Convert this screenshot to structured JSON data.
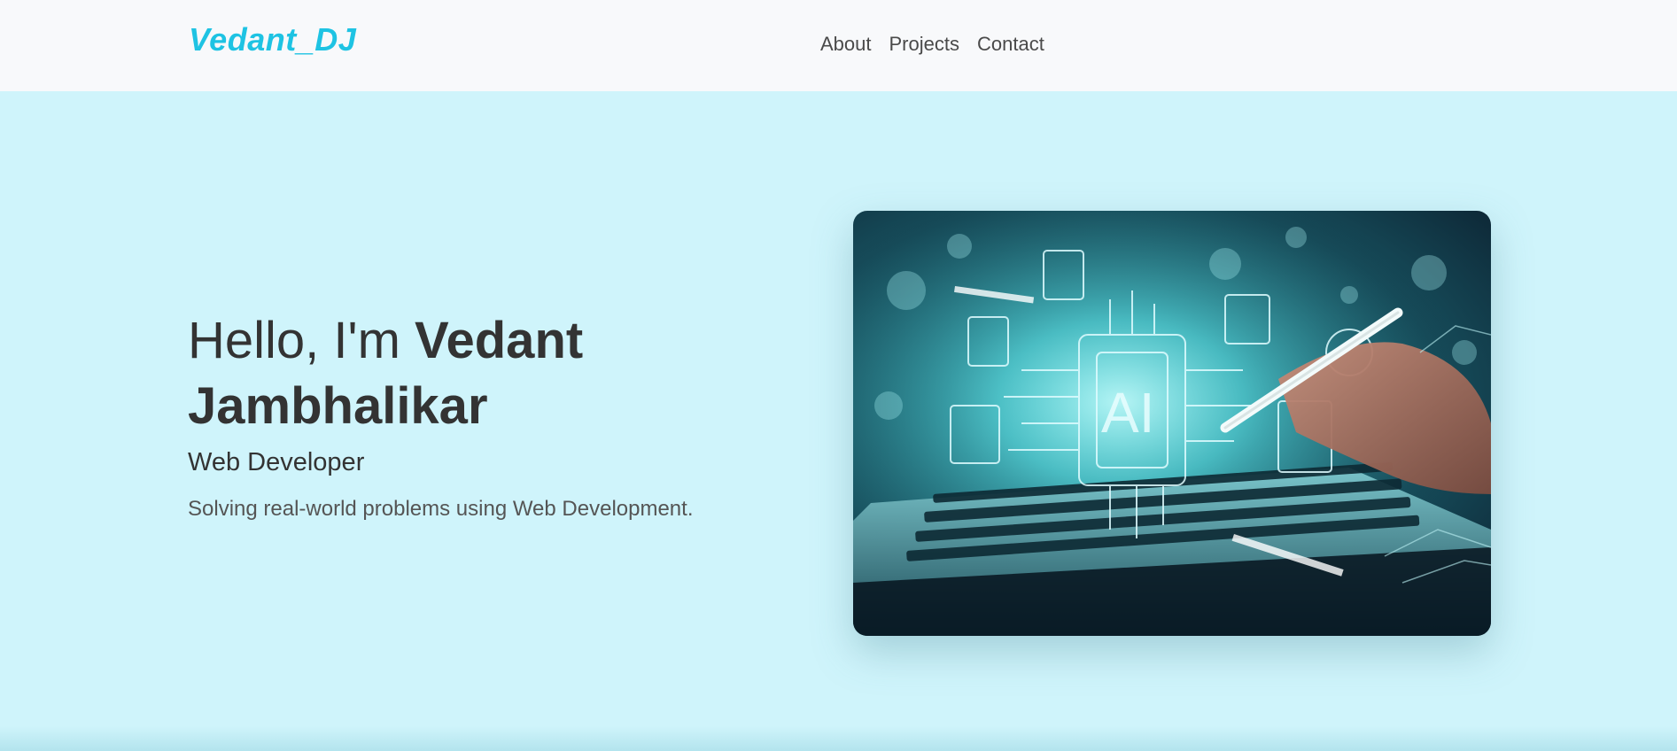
{
  "navbar": {
    "brand": "Vedant_DJ",
    "links": [
      {
        "label": "About"
      },
      {
        "label": "Projects"
      },
      {
        "label": "Contact"
      }
    ]
  },
  "hero": {
    "greeting": "Hello, I'm ",
    "name": "Vedant Jambhalikar",
    "role": "Web Developer",
    "tagline": "Solving real-world problems using Web Development.",
    "image_chip_text": "AI"
  },
  "colors": {
    "brand": "#1ec3e3",
    "header_bg": "#f8f9fb",
    "hero_bg": "#cff4fb",
    "text_dark": "#333333"
  }
}
